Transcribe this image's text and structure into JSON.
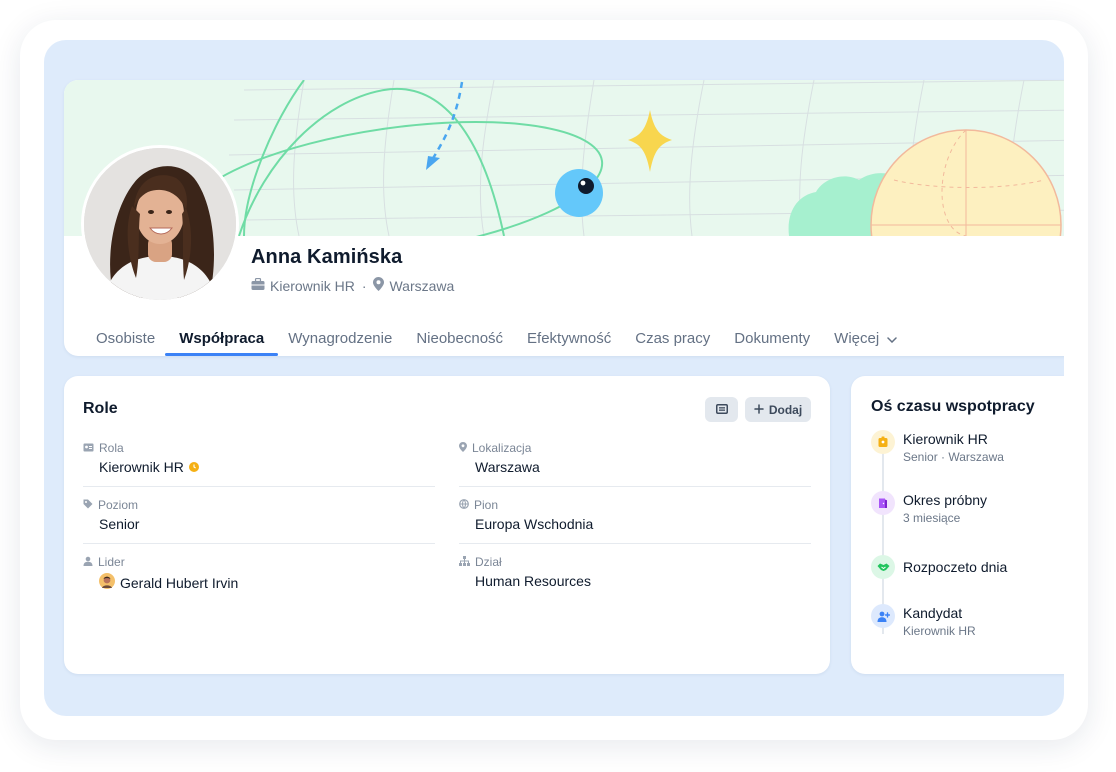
{
  "profile": {
    "name": "Anna Kamińska",
    "position": "Kierownik HR",
    "separator": "·",
    "location": "Warszawa"
  },
  "tabs": [
    {
      "label": "Osobiste",
      "active": false
    },
    {
      "label": "Współpraca",
      "active": true
    },
    {
      "label": "Wynagrodzenie",
      "active": false
    },
    {
      "label": "Nieobecność",
      "active": false
    },
    {
      "label": "Efektywność",
      "active": false
    },
    {
      "label": "Czas pracy",
      "active": false
    },
    {
      "label": "Dokumenty",
      "active": false
    },
    {
      "label": "Więcej",
      "active": false
    }
  ],
  "roles": {
    "title": "Role",
    "add_label": "Dodaj",
    "fields": {
      "rola": {
        "label": "Rola",
        "value": "Kierownik HR"
      },
      "lokalizacja": {
        "label": "Lokalizacja",
        "value": "Warszawa"
      },
      "poziom": {
        "label": "Poziom",
        "value": "Senior"
      },
      "pion": {
        "label": "Pion",
        "value": "Europa Wschodnia"
      },
      "lider": {
        "label": "Lider",
        "value": "Gerald Hubert Irvin"
      },
      "dzial": {
        "label": "Dział",
        "value": "Human Resources"
      }
    }
  },
  "timeline": {
    "title": "Oś czasu wspotpracy",
    "items": [
      {
        "title": "Kierownik HR",
        "subtitle": "Senior · Warszawa",
        "icon": "badge-icon",
        "color": "#f5b014"
      },
      {
        "title": "Okres próbny",
        "subtitle": "3 miesiące",
        "icon": "door-icon",
        "color": "#a855f7"
      },
      {
        "title": "Rozpoczeto dnia",
        "subtitle": "",
        "icon": "handshake-icon",
        "color": "#22c55e"
      },
      {
        "title": "Kandydat",
        "subtitle": "Kierownik HR",
        "icon": "user-plus-icon",
        "color": "#3b82f6"
      }
    ]
  },
  "colors": {
    "background": "#deebfb",
    "accent": "#3b82f6",
    "cover": "#e8f8ee"
  }
}
